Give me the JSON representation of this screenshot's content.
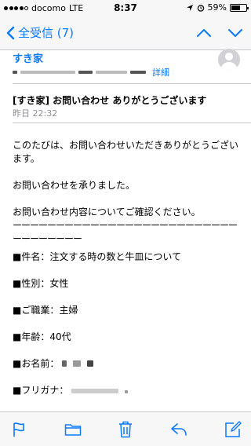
{
  "status_bar": {
    "carrier": "docomo",
    "network": "LTE",
    "time": "8:37",
    "battery": "59%",
    "battery_level": 0.59
  },
  "nav": {
    "back_label": "全受信 (7)"
  },
  "message": {
    "sender": "すき家",
    "detail_link": "詳細",
    "subject": "[すき家] お問い合わせ ありがとうございます",
    "date": "昨日 22:32",
    "body": [
      "このたびは、お問い合わせいただきありがとうございます。",
      "",
      "お問い合わせを承りました。",
      "",
      "お問い合わせ内容についてご確認ください。",
      "ーーーーーーーーーーーーーーーーーーーーーーーーーーーーーーーーーー",
      "■件名：注文する時の数と牛皿について",
      "",
      "■性別：女性",
      "",
      "■ご職業：主婦",
      "",
      "■年齢：40代",
      "",
      "■お名前：",
      "",
      "■フリガナ："
    ]
  },
  "colors": {
    "accent": "#0a7aff",
    "secondary_text": "#8e8e93"
  },
  "icons": {
    "toolbar": [
      "flag-icon",
      "folder-icon",
      "trash-icon",
      "reply-icon",
      "compose-icon"
    ]
  }
}
